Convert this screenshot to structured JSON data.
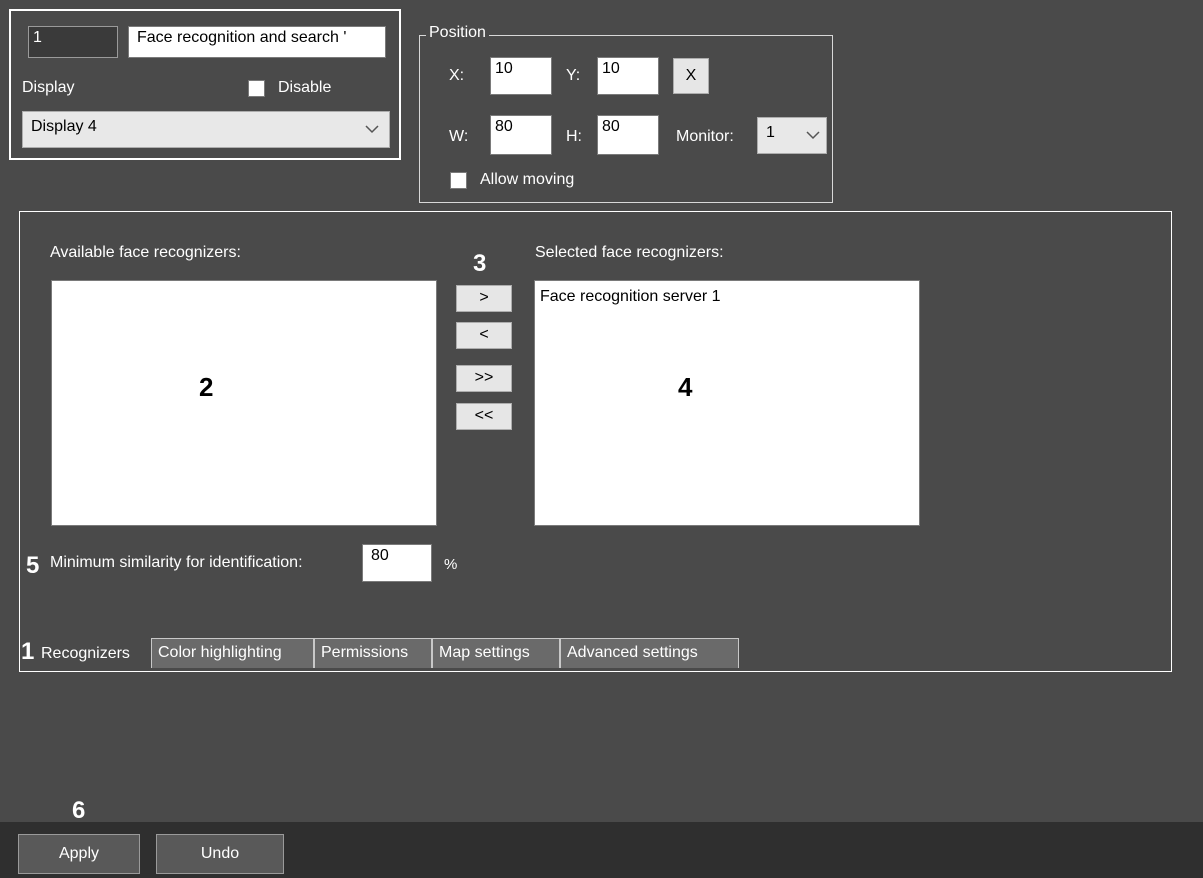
{
  "header": {
    "id_value": "1",
    "name_value": "Face recognition and search '",
    "display_label": "Display",
    "disable_label": "Disable",
    "display_select_value": "Display 4"
  },
  "position": {
    "legend": "Position",
    "x_label": "X:",
    "x_value": "10",
    "y_label": "Y:",
    "y_value": "10",
    "reset_label": "X",
    "w_label": "W:",
    "w_value": "80",
    "h_label": "H:",
    "h_value": "80",
    "monitor_label": "Monitor:",
    "monitor_value": "1",
    "allow_moving_label": "Allow moving"
  },
  "recognizers": {
    "available_label": "Available face recognizers:",
    "selected_label": "Selected face recognizers:",
    "buttons": [
      ">",
      "<",
      ">>",
      "<<"
    ],
    "selected_items": [
      "Face recognition server 1"
    ],
    "min_similarity_label": "Minimum similarity for identification:",
    "min_similarity_value": "80",
    "percent": "%"
  },
  "callouts": {
    "c1": "1",
    "c2": "2",
    "c3": "3",
    "c4": "4",
    "c5": "5",
    "c6": "6"
  },
  "tabs": [
    "Recognizers",
    "Color highlighting",
    "Permissions",
    "Map settings",
    "Advanced settings"
  ],
  "footer": {
    "apply_label": "Apply",
    "undo_label": "Undo"
  },
  "colors": {
    "background": "#4a4a4a",
    "bottom_bar": "#2f2f2f",
    "frame": "#ffffff"
  }
}
